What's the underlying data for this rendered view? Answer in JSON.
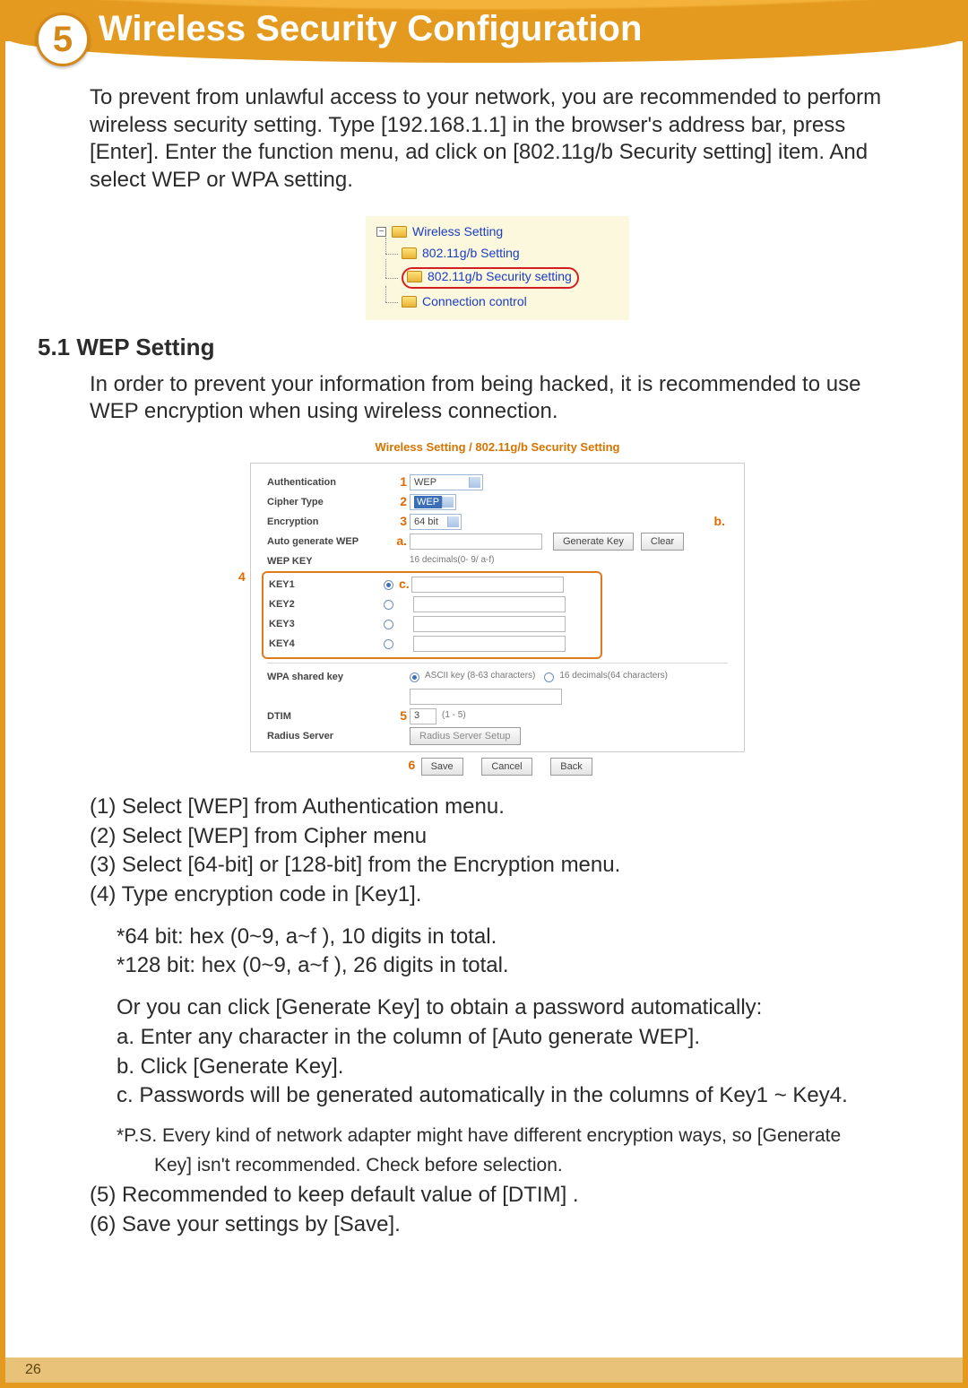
{
  "chapter": {
    "number": "5",
    "title": "Wireless Security Configuration"
  },
  "intro": "To prevent from unlawful access to your network, you are recommended to perform wireless security setting. Type [192.168.1.1] in the browser's address bar, press [Enter]. Enter the function menu, ad click on [802.11g/b Security setting] item. And select WEP or WPA setting.",
  "tree": {
    "root": "Wireless Setting",
    "items": [
      "802.11g/b Setting",
      "802.11g/b Security setting",
      "Connection control"
    ]
  },
  "section": {
    "heading": "5.1 WEP Setting"
  },
  "wep_intro": "In order to prevent your information from being hacked, it is recommended to use WEP encryption when using wireless connection.",
  "form": {
    "breadcrumb": "Wireless Setting / 802.11g/b Security Setting",
    "labels": {
      "auth": "Authentication",
      "cipher": "Cipher Type",
      "enc": "Encryption",
      "autogen": "Auto generate WEP",
      "wepkey": "WEP KEY",
      "key1": "KEY1",
      "key2": "KEY2",
      "key3": "KEY3",
      "key4": "KEY4",
      "wpa": "WPA shared key",
      "dtim": "DTIM",
      "radius": "Radius Server"
    },
    "values": {
      "auth": "WEP",
      "cipher": "WEP",
      "enc": "64 bit",
      "wepnote": "16 decimals(0- 9/ a-f)",
      "wpa_ascii": "ASCII key (8-63 characters)",
      "wpa_hex": "16 decimals(64 characters)",
      "dtim": "3",
      "dtim_range": "(1 - 5)"
    },
    "buttons": {
      "genkey": "Generate Key",
      "clear": "Clear",
      "radius": "Radius Server Setup",
      "save": "Save",
      "cancel": "Cancel",
      "back": "Back"
    },
    "markers": {
      "n1": "1",
      "n2": "2",
      "n3": "3",
      "a": "a.",
      "b": "b.",
      "c": "c.",
      "n4": "4",
      "n5": "5",
      "n6": "6"
    }
  },
  "steps": {
    "s1": "(1) Select [WEP] from Authentication menu.",
    "s2": "(2) Select [WEP] from Cipher menu",
    "s3": "(3) Select [64-bit] or [128-bit] from the Encryption menu.",
    "s4": "(4) Type encryption code in [Key1].",
    "h64": "*64 bit: hex (0~9, a~f ), 10 digits in total.",
    "h128": "*128 bit: hex (0~9, a~f ), 26 digits in total.",
    "or": "Or you can click [Generate Key] to obtain a password automatically:",
    "a": "a. Enter any character in the column of [Auto generate WEP].",
    "b": "b. Click [Generate Key].",
    "c": "c. Passwords will be generated automatically in the columns of Key1 ~ Key4.",
    "ps": "*P.S. Every kind of network adapter might have different encryption ways, so [Generate",
    "ps2": "Key] isn't recommended. Check before selection.",
    "s5": "(5) Recommended to keep default value of [DTIM] .",
    "s6": "(6) Save your settings by [Save]."
  },
  "page_number": "26"
}
